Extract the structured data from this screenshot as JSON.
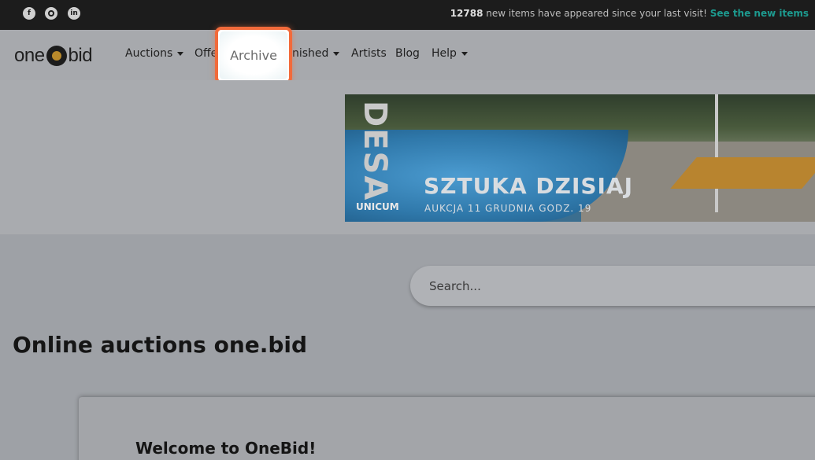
{
  "topbar": {
    "social": [
      "facebook-icon",
      "instagram-icon",
      "linkedin-icon"
    ],
    "count": "12788",
    "notice_text": " new items have appeared since your last visit! ",
    "new_items_link": "See the new items"
  },
  "nav": {
    "logo_left": "one",
    "logo_right": "bid",
    "items": [
      {
        "label": "Auctions",
        "dropdown": true
      },
      {
        "label": "Offe",
        "dropdown": false
      },
      {
        "label": "Archive",
        "dropdown": false
      },
      {
        "label": "nished",
        "dropdown": true
      },
      {
        "label": "Artists",
        "dropdown": false
      },
      {
        "label": "Blog",
        "dropdown": false
      },
      {
        "label": "Help",
        "dropdown": true
      }
    ]
  },
  "banner": {
    "brand": "DESA",
    "sub_brand": "UNICUM",
    "headline": "SZTUKA DZISIAJ",
    "subline": "AUKCJA 11 GRUDNIA GODZ. 19"
  },
  "search": {
    "placeholder": "Search..."
  },
  "page_title": "Online auctions one.bid",
  "welcome": {
    "title": "Welcome to OneBid!"
  },
  "colors": {
    "highlight": "#f26a3a",
    "link": "#1d9a8f"
  }
}
